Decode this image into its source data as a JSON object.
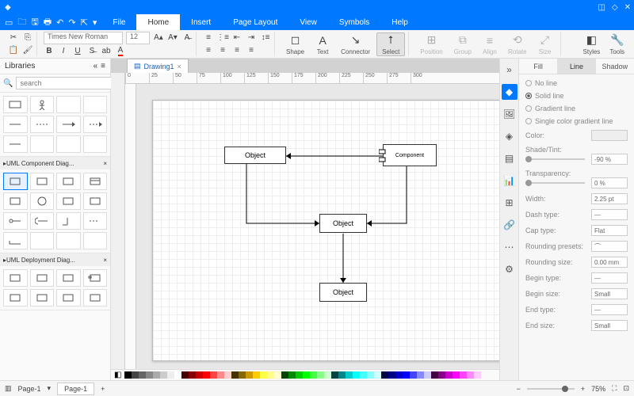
{
  "menus": {
    "file": "File",
    "home": "Home",
    "insert": "Insert",
    "page_layout": "Page Layout",
    "view": "View",
    "symbols": "Symbols",
    "help": "Help"
  },
  "ribbon": {
    "font_name": "Times New Roman",
    "font_size": "12",
    "shape": "Shape",
    "text": "Text",
    "connector": "Connector",
    "select": "Select",
    "position": "Position",
    "group": "Group",
    "align": "Align",
    "rotate": "Rotate",
    "size": "Size",
    "styles": "Styles",
    "tools": "Tools"
  },
  "libraries": {
    "title": "Libraries",
    "search_placeholder": "search",
    "sections": {
      "basic": "",
      "uml_comp": "UML Component Diag...",
      "uml_deploy": "UML Deployment Diag..."
    }
  },
  "doc": {
    "tab": "Drawing1"
  },
  "diagram": {
    "obj1": "Object",
    "obj2": "Object",
    "obj3": "Object",
    "comp": "Component"
  },
  "rpanel": {
    "tabs": {
      "fill": "Fill",
      "line": "Line",
      "shadow": "Shadow"
    },
    "no_line": "No line",
    "solid_line": "Solid line",
    "gradient_line": "Gradient line",
    "single_color": "Single color gradient line",
    "color": "Color:",
    "shade": "Shade/Tint:",
    "shade_val": "-90 %",
    "transparency": "Transparency:",
    "transp_val": "0 %",
    "width": "Width:",
    "width_val": "2.25 pt",
    "dash": "Dash type:",
    "cap": "Cap type:",
    "cap_val": "Flat",
    "round_presets": "Rounding presets:",
    "round_size": "Rounding size:",
    "round_val": "0.00 mm",
    "begin_type": "Begin type:",
    "begin_size": "Begin size:",
    "begin_sv": "Small",
    "end_type": "End type:",
    "end_size": "End size:",
    "end_sv": "Small"
  },
  "status": {
    "page": "Page-1",
    "page_tab": "Page-1",
    "zoom": "75%"
  },
  "ruler_ticks": [
    "0",
    "25",
    "50",
    "75",
    "100",
    "125",
    "150",
    "175",
    "200",
    "225",
    "250",
    "275",
    "300"
  ]
}
